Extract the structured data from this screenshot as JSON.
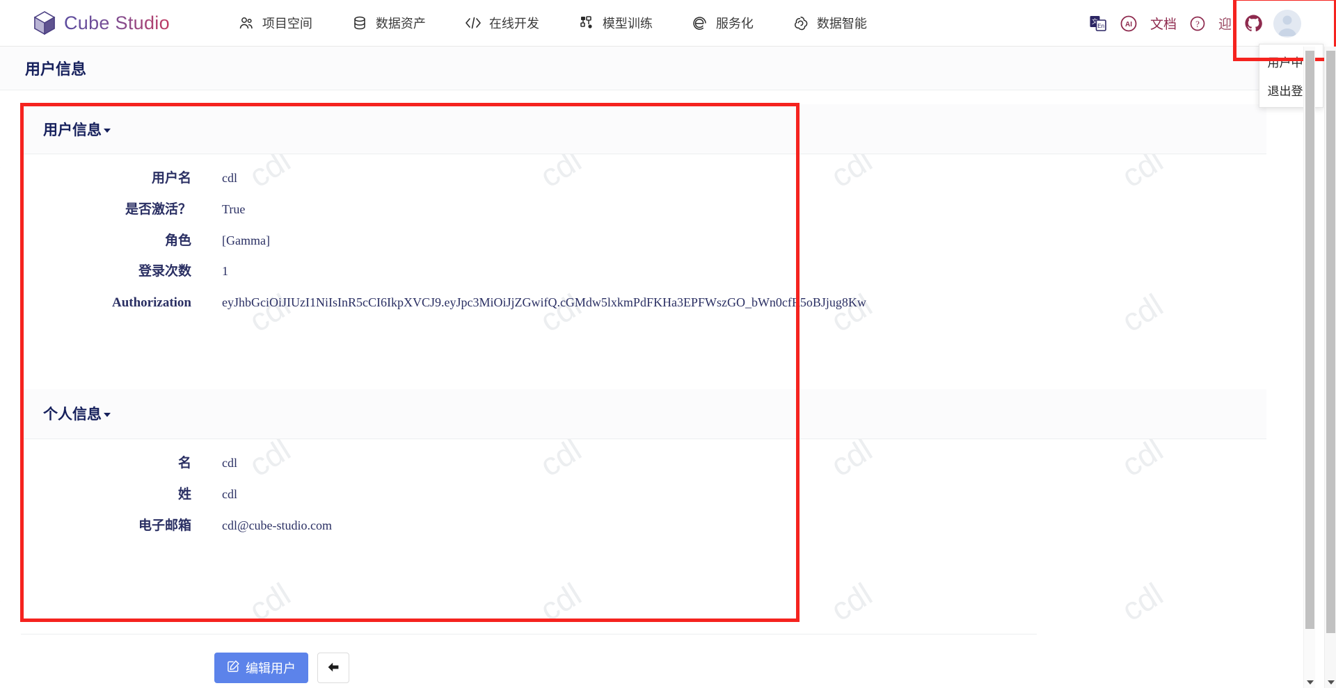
{
  "navbar": {
    "brand": "Cube Studio",
    "items": [
      {
        "label": "项目空间",
        "icon": "users-icon"
      },
      {
        "label": "数据资产",
        "icon": "database-icon"
      },
      {
        "label": "在线开发",
        "icon": "code-icon"
      },
      {
        "label": "模型训练",
        "icon": "pipeline-icon"
      },
      {
        "label": "服务化",
        "icon": "browser-icon"
      },
      {
        "label": "数据智能",
        "icon": "spiral-icon"
      }
    ],
    "right": {
      "translate_icon": "translate-icon",
      "ai_icon": "ai-circle-icon",
      "doc_label": "文档",
      "help_icon": "question-circle-icon",
      "partial_label": "迎",
      "github_icon": "github-icon",
      "avatar_icon": "avatar-icon"
    },
    "dropdown": {
      "items": [
        "用户中心",
        "退出登录"
      ]
    }
  },
  "page": {
    "title": "用户信息"
  },
  "sections": [
    {
      "title": "用户信息",
      "rows": [
        {
          "label": "用户名",
          "value": "cdl"
        },
        {
          "label": "是否激活？",
          "value": "True"
        },
        {
          "label": "角色",
          "value": "[Gamma]"
        },
        {
          "label": "登录次数",
          "value": "1"
        },
        {
          "label": "Authorization",
          "value": "eyJhbGciOiJIUzI1NiIsInR5cCI6IkpXVCJ9.eyJpc3MiOiJjZGwifQ.cGMdw5lxkmPdFKHa3EPFWszGO_bWn0cfR5oBJjug8Kw"
        }
      ]
    },
    {
      "title": "个人信息",
      "rows": [
        {
          "label": "名",
          "value": "cdl"
        },
        {
          "label": "姓",
          "value": "cdl"
        },
        {
          "label": "电子邮箱",
          "value": "cdl@cube-studio.com"
        }
      ]
    }
  ],
  "footer": {
    "edit_label": "编辑用户",
    "edit_icon": "edit-square-icon",
    "back_icon": "arrow-left-icon"
  },
  "watermark": {
    "text": "cdl"
  },
  "colors": {
    "highlight": "#f5231f",
    "primary_button": "#5c83ea",
    "heading": "#16205c",
    "field_text": "#2a2f63",
    "nav_right_text": "#8e2a4e"
  }
}
